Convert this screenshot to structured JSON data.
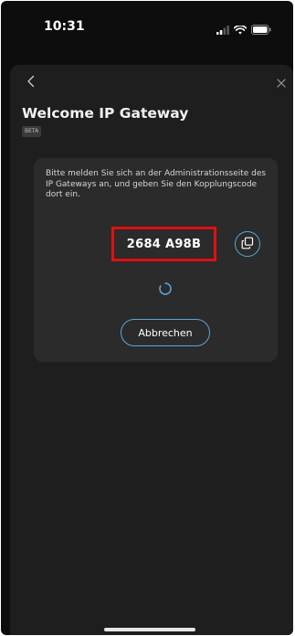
{
  "status_bar": {
    "time": "10:31",
    "icons": [
      "signal-icon",
      "wifi-icon",
      "battery-icon"
    ]
  },
  "header": {
    "back_icon": "chevron-left-icon",
    "close_icon": "close-icon"
  },
  "title": "Welcome IP Gateway",
  "badge": "BETA",
  "card": {
    "instructions": "Bitte melden Sie sich an der Administrationsseite des IP Gateways an, und geben Sie den Kopplungscode dort ein.",
    "code": "2684 A98B",
    "copy_icon": "copy-icon",
    "spinner_icon": "loading-spinner-icon",
    "cancel_label": "Abbrechen"
  },
  "colors": {
    "background": "#0d0d0d",
    "sheet": "#1e1e1e",
    "card": "#2b2b2b",
    "accent": "#5aa6d8",
    "highlight": "#e01010"
  }
}
